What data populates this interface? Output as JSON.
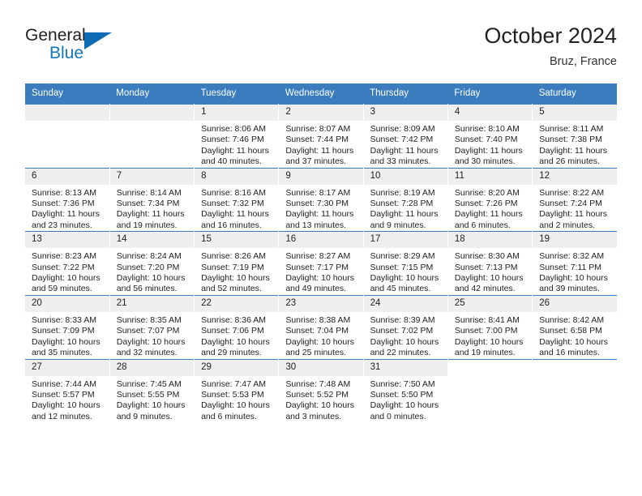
{
  "brand": {
    "word1": "General",
    "word2": "Blue",
    "triangle_color": "#0f6cb2"
  },
  "header": {
    "title": "October 2024",
    "subtitle": "Bruz, France",
    "accent_color": "#3a7cbe"
  },
  "weekday_headers": [
    "Sunday",
    "Monday",
    "Tuesday",
    "Wednesday",
    "Thursday",
    "Friday",
    "Saturday"
  ],
  "labels": {
    "sunrise": "Sunrise:",
    "sunset": "Sunset:",
    "daylight": "Daylight:"
  },
  "weeks": [
    [
      {
        "day": "",
        "empty": true
      },
      {
        "day": "",
        "empty": true
      },
      {
        "day": "1",
        "sunrise": "Sunrise: 8:06 AM",
        "sunset": "Sunset: 7:46 PM",
        "daylight_line1": "Daylight: 11 hours",
        "daylight_line2": "and 40 minutes."
      },
      {
        "day": "2",
        "sunrise": "Sunrise: 8:07 AM",
        "sunset": "Sunset: 7:44 PM",
        "daylight_line1": "Daylight: 11 hours",
        "daylight_line2": "and 37 minutes."
      },
      {
        "day": "3",
        "sunrise": "Sunrise: 8:09 AM",
        "sunset": "Sunset: 7:42 PM",
        "daylight_line1": "Daylight: 11 hours",
        "daylight_line2": "and 33 minutes."
      },
      {
        "day": "4",
        "sunrise": "Sunrise: 8:10 AM",
        "sunset": "Sunset: 7:40 PM",
        "daylight_line1": "Daylight: 11 hours",
        "daylight_line2": "and 30 minutes."
      },
      {
        "day": "5",
        "sunrise": "Sunrise: 8:11 AM",
        "sunset": "Sunset: 7:38 PM",
        "daylight_line1": "Daylight: 11 hours",
        "daylight_line2": "and 26 minutes."
      }
    ],
    [
      {
        "day": "6",
        "sunrise": "Sunrise: 8:13 AM",
        "sunset": "Sunset: 7:36 PM",
        "daylight_line1": "Daylight: 11 hours",
        "daylight_line2": "and 23 minutes."
      },
      {
        "day": "7",
        "sunrise": "Sunrise: 8:14 AM",
        "sunset": "Sunset: 7:34 PM",
        "daylight_line1": "Daylight: 11 hours",
        "daylight_line2": "and 19 minutes."
      },
      {
        "day": "8",
        "sunrise": "Sunrise: 8:16 AM",
        "sunset": "Sunset: 7:32 PM",
        "daylight_line1": "Daylight: 11 hours",
        "daylight_line2": "and 16 minutes."
      },
      {
        "day": "9",
        "sunrise": "Sunrise: 8:17 AM",
        "sunset": "Sunset: 7:30 PM",
        "daylight_line1": "Daylight: 11 hours",
        "daylight_line2": "and 13 minutes."
      },
      {
        "day": "10",
        "sunrise": "Sunrise: 8:19 AM",
        "sunset": "Sunset: 7:28 PM",
        "daylight_line1": "Daylight: 11 hours",
        "daylight_line2": "and 9 minutes."
      },
      {
        "day": "11",
        "sunrise": "Sunrise: 8:20 AM",
        "sunset": "Sunset: 7:26 PM",
        "daylight_line1": "Daylight: 11 hours",
        "daylight_line2": "and 6 minutes."
      },
      {
        "day": "12",
        "sunrise": "Sunrise: 8:22 AM",
        "sunset": "Sunset: 7:24 PM",
        "daylight_line1": "Daylight: 11 hours",
        "daylight_line2": "and 2 minutes."
      }
    ],
    [
      {
        "day": "13",
        "sunrise": "Sunrise: 8:23 AM",
        "sunset": "Sunset: 7:22 PM",
        "daylight_line1": "Daylight: 10 hours",
        "daylight_line2": "and 59 minutes."
      },
      {
        "day": "14",
        "sunrise": "Sunrise: 8:24 AM",
        "sunset": "Sunset: 7:20 PM",
        "daylight_line1": "Daylight: 10 hours",
        "daylight_line2": "and 56 minutes."
      },
      {
        "day": "15",
        "sunrise": "Sunrise: 8:26 AM",
        "sunset": "Sunset: 7:19 PM",
        "daylight_line1": "Daylight: 10 hours",
        "daylight_line2": "and 52 minutes."
      },
      {
        "day": "16",
        "sunrise": "Sunrise: 8:27 AM",
        "sunset": "Sunset: 7:17 PM",
        "daylight_line1": "Daylight: 10 hours",
        "daylight_line2": "and 49 minutes."
      },
      {
        "day": "17",
        "sunrise": "Sunrise: 8:29 AM",
        "sunset": "Sunset: 7:15 PM",
        "daylight_line1": "Daylight: 10 hours",
        "daylight_line2": "and 45 minutes."
      },
      {
        "day": "18",
        "sunrise": "Sunrise: 8:30 AM",
        "sunset": "Sunset: 7:13 PM",
        "daylight_line1": "Daylight: 10 hours",
        "daylight_line2": "and 42 minutes."
      },
      {
        "day": "19",
        "sunrise": "Sunrise: 8:32 AM",
        "sunset": "Sunset: 7:11 PM",
        "daylight_line1": "Daylight: 10 hours",
        "daylight_line2": "and 39 minutes."
      }
    ],
    [
      {
        "day": "20",
        "sunrise": "Sunrise: 8:33 AM",
        "sunset": "Sunset: 7:09 PM",
        "daylight_line1": "Daylight: 10 hours",
        "daylight_line2": "and 35 minutes."
      },
      {
        "day": "21",
        "sunrise": "Sunrise: 8:35 AM",
        "sunset": "Sunset: 7:07 PM",
        "daylight_line1": "Daylight: 10 hours",
        "daylight_line2": "and 32 minutes."
      },
      {
        "day": "22",
        "sunrise": "Sunrise: 8:36 AM",
        "sunset": "Sunset: 7:06 PM",
        "daylight_line1": "Daylight: 10 hours",
        "daylight_line2": "and 29 minutes."
      },
      {
        "day": "23",
        "sunrise": "Sunrise: 8:38 AM",
        "sunset": "Sunset: 7:04 PM",
        "daylight_line1": "Daylight: 10 hours",
        "daylight_line2": "and 25 minutes."
      },
      {
        "day": "24",
        "sunrise": "Sunrise: 8:39 AM",
        "sunset": "Sunset: 7:02 PM",
        "daylight_line1": "Daylight: 10 hours",
        "daylight_line2": "and 22 minutes."
      },
      {
        "day": "25",
        "sunrise": "Sunrise: 8:41 AM",
        "sunset": "Sunset: 7:00 PM",
        "daylight_line1": "Daylight: 10 hours",
        "daylight_line2": "and 19 minutes."
      },
      {
        "day": "26",
        "sunrise": "Sunrise: 8:42 AM",
        "sunset": "Sunset: 6:58 PM",
        "daylight_line1": "Daylight: 10 hours",
        "daylight_line2": "and 16 minutes."
      }
    ],
    [
      {
        "day": "27",
        "sunrise": "Sunrise: 7:44 AM",
        "sunset": "Sunset: 5:57 PM",
        "daylight_line1": "Daylight: 10 hours",
        "daylight_line2": "and 12 minutes."
      },
      {
        "day": "28",
        "sunrise": "Sunrise: 7:45 AM",
        "sunset": "Sunset: 5:55 PM",
        "daylight_line1": "Daylight: 10 hours",
        "daylight_line2": "and 9 minutes."
      },
      {
        "day": "29",
        "sunrise": "Sunrise: 7:47 AM",
        "sunset": "Sunset: 5:53 PM",
        "daylight_line1": "Daylight: 10 hours",
        "daylight_line2": "and 6 minutes."
      },
      {
        "day": "30",
        "sunrise": "Sunrise: 7:48 AM",
        "sunset": "Sunset: 5:52 PM",
        "daylight_line1": "Daylight: 10 hours",
        "daylight_line2": "and 3 minutes."
      },
      {
        "day": "31",
        "sunrise": "Sunrise: 7:50 AM",
        "sunset": "Sunset: 5:50 PM",
        "daylight_line1": "Daylight: 10 hours",
        "daylight_line2": "and 0 minutes."
      },
      {
        "day": "",
        "blank": true
      },
      {
        "day": "",
        "blank": true
      }
    ]
  ]
}
